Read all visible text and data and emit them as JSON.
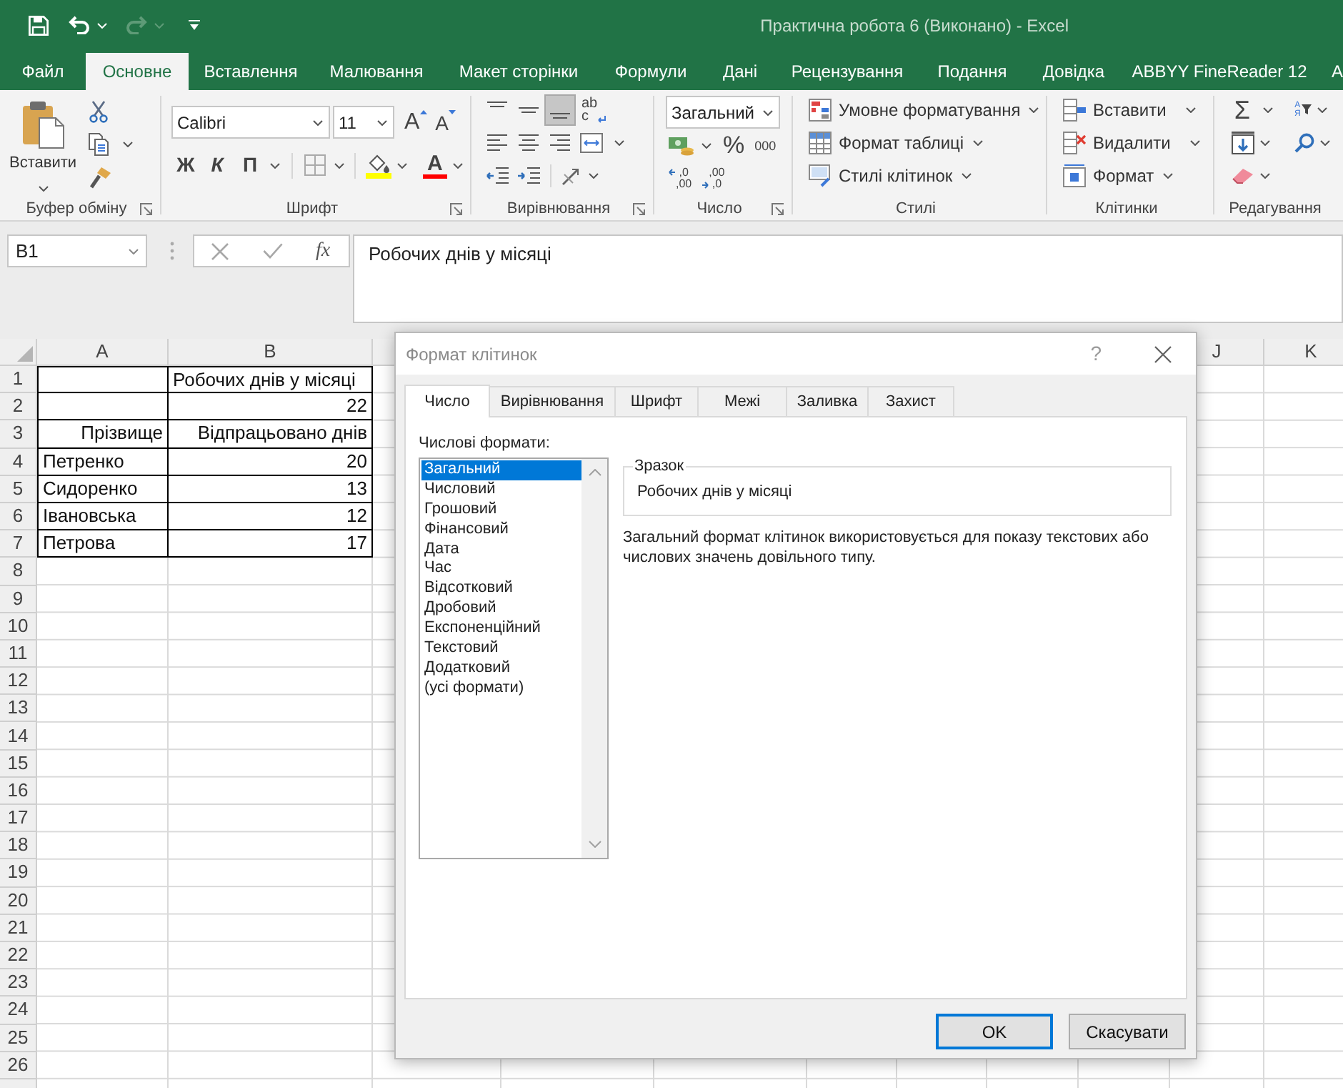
{
  "window": {
    "title": "Практична робота 6 (Виконано) - Excel"
  },
  "quick_access": [
    {
      "kind": "save",
      "disabled": false
    },
    {
      "kind": "undo",
      "disabled": false
    },
    {
      "kind": "redo",
      "disabled": true
    },
    {
      "kind": "customize",
      "disabled": false
    }
  ],
  "ribbon_tabs": [
    {
      "label": "Файл",
      "selected": false
    },
    {
      "label": "Основне",
      "selected": true
    },
    {
      "label": "Вставлення",
      "selected": false
    },
    {
      "label": "Малювання",
      "selected": false
    },
    {
      "label": "Макет сторінки",
      "selected": false
    },
    {
      "label": "Формули",
      "selected": false
    },
    {
      "label": "Дані",
      "selected": false
    },
    {
      "label": "Рецензування",
      "selected": false
    },
    {
      "label": "Подання",
      "selected": false
    },
    {
      "label": "Довідка",
      "selected": false
    },
    {
      "label": "ABBYY FineReader 12",
      "selected": false
    },
    {
      "label": "A",
      "selected": false
    }
  ],
  "ribbon_groups": [
    {
      "kind": "clipboard",
      "label": "Буфер обміну",
      "paste": "Вставити"
    },
    {
      "kind": "font",
      "label": "Шрифт",
      "font_name": "Calibri",
      "font_size": "11",
      "grow": "A",
      "shrink": "A",
      "bold": "Ж",
      "italic": "К",
      "underline": "П",
      "font_color": "A"
    },
    {
      "kind": "alignment",
      "label": "Вирівнювання",
      "vertical_align": [
        {
          "kind": "top",
          "selected": false
        },
        {
          "kind": "middle",
          "selected": false
        },
        {
          "kind": "bottom",
          "selected": true
        }
      ],
      "wrap": [
        "ab",
        "c"
      ],
      "horizontal_align": [
        {
          "kind": "left",
          "selected": false
        },
        {
          "kind": "center",
          "selected": false
        },
        {
          "kind": "right",
          "selected": false
        }
      ]
    },
    {
      "kind": "number",
      "label": "Число",
      "format": "Загальний",
      "percent": "%",
      "thousands": "000",
      "increase_decimal": [
        ",0",
        ",00"
      ],
      "decrease_decimal": [
        ",00",
        ",0"
      ]
    },
    {
      "kind": "styles",
      "label": "Стилі",
      "commands": [
        {
          "kind": "conditional",
          "label": "Умовне форматування"
        },
        {
          "kind": "table",
          "label": "Формат таблиці"
        },
        {
          "kind": "cell_styles",
          "label": "Стилі клітинок"
        }
      ]
    },
    {
      "kind": "cells",
      "label": "Клітинки",
      "commands": [
        {
          "kind": "insert",
          "label": "Вставити"
        },
        {
          "kind": "delete",
          "label": "Видалити"
        },
        {
          "kind": "format",
          "label": "Формат"
        }
      ]
    },
    {
      "kind": "editing",
      "label": "Редагування",
      "autosum": "Σ",
      "sort": [
        "А",
        "Я"
      ]
    }
  ],
  "formula_bar": {
    "name_box": "B1",
    "function_label": "fx",
    "content": "Робочих днів у місяці"
  },
  "sheet": {
    "columns": [
      "A",
      "B",
      "J",
      "K"
    ],
    "rows": [
      {
        "number": "1",
        "bordered": true,
        "b": {
          "text": "Робочих днів у місяці",
          "right_aligned": false
        }
      },
      {
        "number": "2",
        "bordered": true,
        "b": {
          "text": "22",
          "right_aligned": true
        }
      },
      {
        "number": "3",
        "bordered": true,
        "a": {
          "text": "Прізвище",
          "right_aligned": true
        },
        "b": {
          "text": "Відпрацьовано днів",
          "right_aligned": true
        }
      },
      {
        "number": "4",
        "bordered": true,
        "a": {
          "text": "Петренко",
          "right_aligned": false
        },
        "b": {
          "text": "20",
          "right_aligned": true
        }
      },
      {
        "number": "5",
        "bordered": true,
        "a": {
          "text": "Сидоренко",
          "right_aligned": false
        },
        "b": {
          "text": "13",
          "right_aligned": true
        }
      },
      {
        "number": "6",
        "bordered": true,
        "a": {
          "text": "Івановська",
          "right_aligned": false
        },
        "b": {
          "text": "12",
          "right_aligned": true
        }
      },
      {
        "number": "7",
        "bordered": true,
        "a": {
          "text": "Петрова",
          "right_aligned": false
        },
        "b": {
          "text": "17",
          "right_aligned": true
        }
      },
      {
        "number": "8",
        "bordered": false
      },
      {
        "number": "9",
        "bordered": false
      },
      {
        "number": "10",
        "bordered": false
      },
      {
        "number": "11",
        "bordered": false
      },
      {
        "number": "12",
        "bordered": false
      },
      {
        "number": "13",
        "bordered": false
      },
      {
        "number": "14",
        "bordered": false
      },
      {
        "number": "15",
        "bordered": false
      },
      {
        "number": "16",
        "bordered": false
      },
      {
        "number": "17",
        "bordered": false
      },
      {
        "number": "18",
        "bordered": false
      },
      {
        "number": "19",
        "bordered": false
      },
      {
        "number": "20",
        "bordered": false
      },
      {
        "number": "21",
        "bordered": false
      },
      {
        "number": "22",
        "bordered": false
      },
      {
        "number": "23",
        "bordered": false
      },
      {
        "number": "24",
        "bordered": false
      },
      {
        "number": "25",
        "bordered": false
      },
      {
        "number": "26",
        "bordered": false
      }
    ]
  },
  "dialog": {
    "title": "Формат клітинок",
    "help": "?",
    "tabs": [
      {
        "label": "Число",
        "selected": true
      },
      {
        "label": "Вирівнювання",
        "selected": false
      },
      {
        "label": "Шрифт",
        "selected": false
      },
      {
        "label": "Межі",
        "selected": false
      },
      {
        "label": "Заливка",
        "selected": false
      },
      {
        "label": "Захист",
        "selected": false
      }
    ],
    "category_label": "Числові формати:",
    "categories": [
      {
        "label": "Загальний",
        "selected": true
      },
      {
        "label": "Числовий",
        "selected": false
      },
      {
        "label": "Грошовий",
        "selected": false
      },
      {
        "label": "Фінансовий",
        "selected": false
      },
      {
        "label": "Дата",
        "selected": false
      },
      {
        "label": "Час",
        "selected": false
      },
      {
        "label": "Відсотковий",
        "selected": false
      },
      {
        "label": "Дробовий",
        "selected": false
      },
      {
        "label": "Експоненційний",
        "selected": false
      },
      {
        "label": "Текстовий",
        "selected": false
      },
      {
        "label": "Додатковий",
        "selected": false
      },
      {
        "label": "(усі формати)",
        "selected": false
      }
    ],
    "sample_label": "Зразок",
    "sample": "Робочих днів у місяці",
    "description": "Загальний формат клітинок використовується для показу текстових або числових значень довільного типу.",
    "buttons": [
      {
        "label": "OK",
        "default": true
      },
      {
        "label": "Скасувати",
        "default": false
      }
    ]
  }
}
